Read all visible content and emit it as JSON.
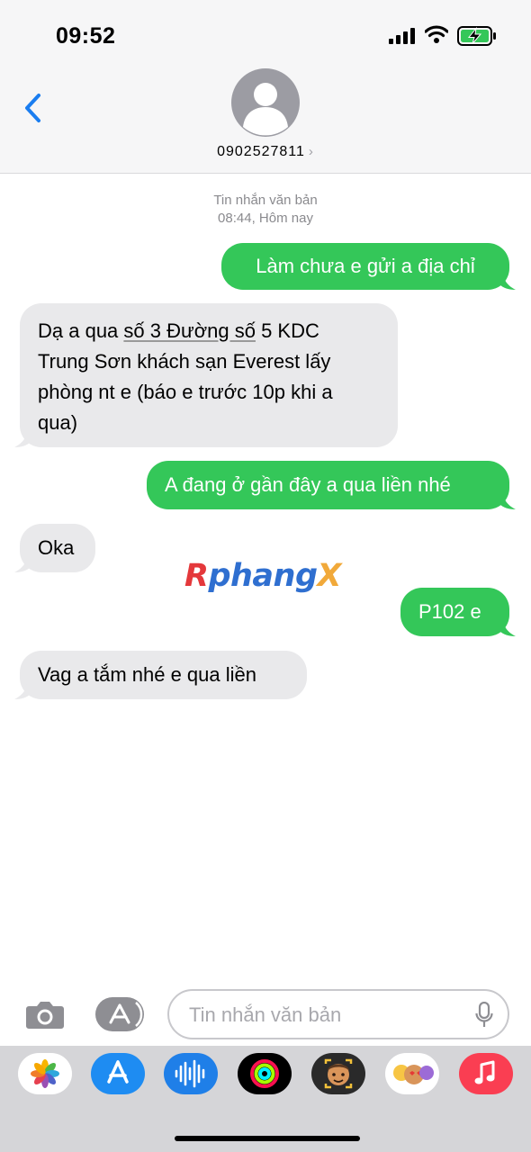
{
  "status_bar": {
    "time": "09:52"
  },
  "header": {
    "contact": "0902527811",
    "chevron": "›"
  },
  "thread": {
    "label": "Tin nhắn văn bản",
    "timestamp": "08:44, Hôm nay",
    "messages": [
      {
        "direction": "outgoing",
        "text": "Làm chưa e gửi a địa chỉ"
      },
      {
        "direction": "incoming",
        "lines": [
          "Dạ a qua ",
          "số 3 Đường số",
          " 5 KDC",
          "Trung Sơn khách sạn Everest lấy",
          "phòng nt e (báo e trước 10p khi a",
          "qua)"
        ]
      },
      {
        "direction": "outgoing",
        "text": "A đang ở gần đây a qua liền nhé"
      },
      {
        "direction": "incoming",
        "text": "Oka"
      },
      {
        "direction": "outgoing",
        "text": "P102 e"
      },
      {
        "direction": "incoming",
        "text": "Vag a tắm nhé e qua liền"
      }
    ]
  },
  "watermark": {
    "r": "R",
    "mid": "phang",
    "x": "X"
  },
  "composer": {
    "placeholder": "Tin nhắn văn bản"
  },
  "app_tray": [
    "photos-app",
    "app-store",
    "audio-messages",
    "activity",
    "memoji",
    "memoji-stickers",
    "music"
  ],
  "colors": {
    "outgoing": "#34c759",
    "incoming": "#e9e9eb",
    "accent": "#1a7df0"
  }
}
